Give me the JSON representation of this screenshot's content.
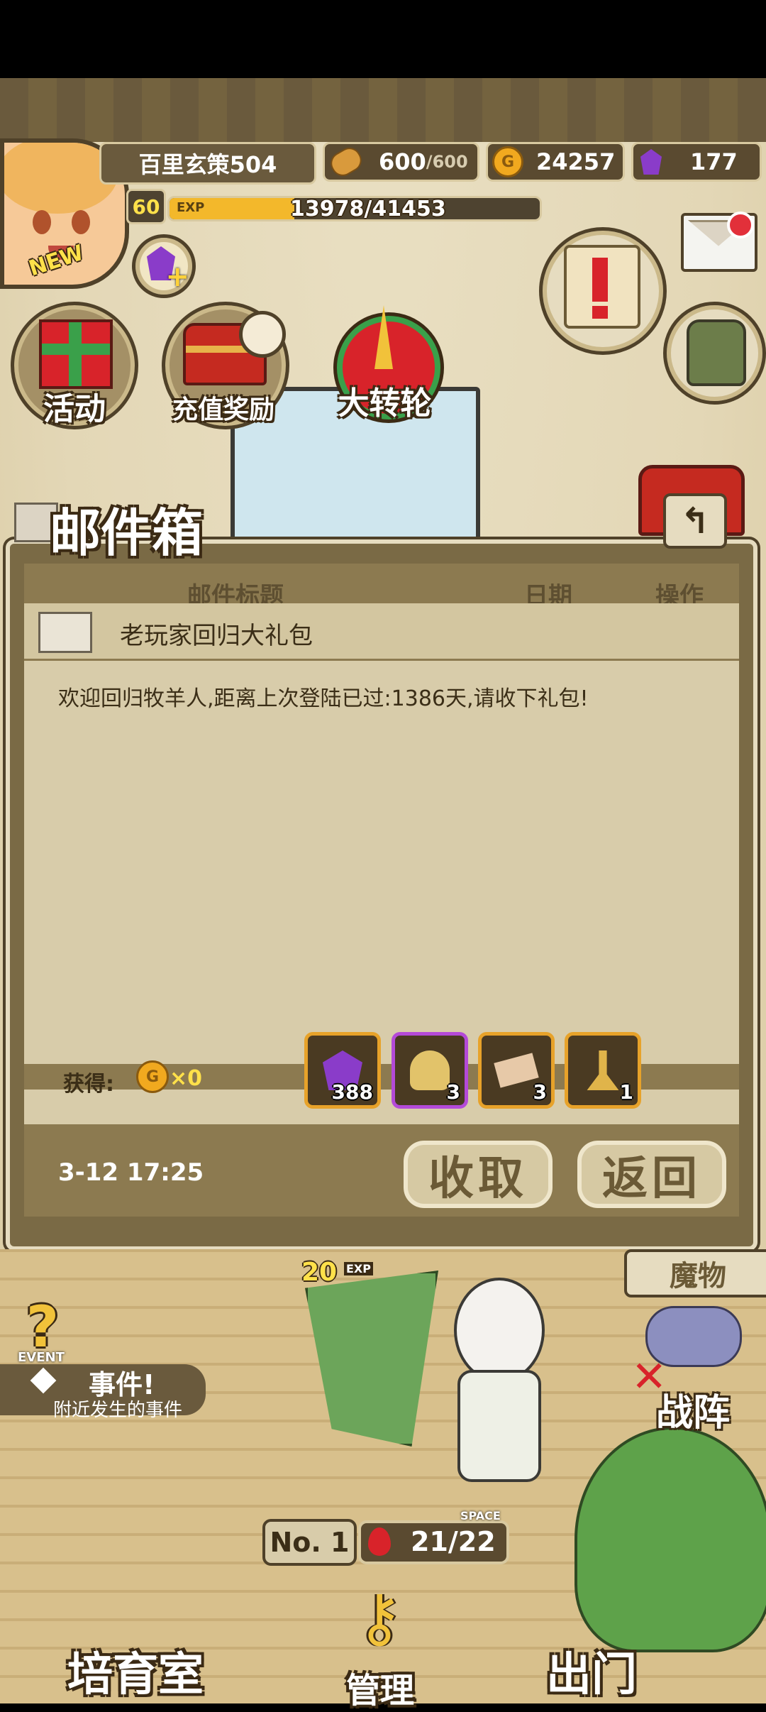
{
  "player": {
    "name": "百里玄策504",
    "level": "60",
    "exp_label": "EXP",
    "exp_text": "13978/41453",
    "exp_fraction": 0.337,
    "new_badge": "NEW"
  },
  "resources": {
    "stamina_value": "600",
    "stamina_max": "/600",
    "gold": "24257",
    "gems": "177"
  },
  "menu": {
    "event_button": "活动",
    "recharge_button": "充值奖励",
    "wheel_button": "大转轮"
  },
  "mailbox": {
    "title": "邮件箱",
    "col_title": "邮件标题",
    "col_date": "日期",
    "col_action": "操作",
    "mail_subject": "老玩家回归大礼包",
    "mail_body": "欢迎回归牧羊人,距离上次登陆已过:1386天,请收下礼包!",
    "obtain_label": "获得:",
    "gold_reward": "×0",
    "items": [
      {
        "icon": "gem-icon",
        "count": "388"
      },
      {
        "icon": "shell-icon",
        "count": "3"
      },
      {
        "icon": "ticket-icon",
        "count": "3"
      },
      {
        "icon": "key-icon",
        "count": "1"
      }
    ],
    "date": "3-12 17:25",
    "collect_button": "收取",
    "back_button": "返回"
  },
  "field": {
    "monster_tab": "魔物",
    "formation_tab": "战阵",
    "event_tag": "EVENT",
    "event_title": "事件!",
    "event_subtitle": "附近发生的事件",
    "exp_float": "20",
    "exp_float_label": "EXP",
    "rank": "No. 1",
    "space_label": "SPACE",
    "space_value": "21/22"
  },
  "nav": {
    "nursery": "培育室",
    "manage": "管理",
    "depart": "出门"
  },
  "colors": {
    "gold_bar": "#f3b82b",
    "panel_brown": "#7a6a45",
    "parchment": "#d8ccaa",
    "gem_purple": "#8a3cc9",
    "notify_red": "#e2303a"
  }
}
